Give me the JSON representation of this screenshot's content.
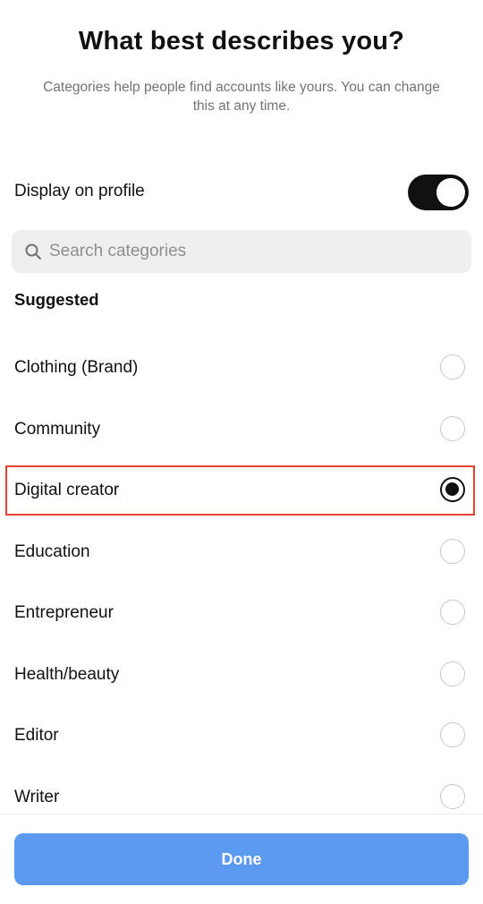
{
  "header": {
    "title": "What best describes you?",
    "subtitle": "Categories help people find accounts like yours. You can change this at any time."
  },
  "display_on_profile": {
    "label": "Display on profile",
    "enabled": true
  },
  "search": {
    "icon": "search-icon",
    "placeholder": "Search categories",
    "value": ""
  },
  "suggested": {
    "heading": "Suggested",
    "items": [
      {
        "label": "Clothing (Brand)",
        "selected": false
      },
      {
        "label": "Community",
        "selected": false
      },
      {
        "label": "Digital creator",
        "selected": true,
        "highlighted": true
      },
      {
        "label": "Education",
        "selected": false
      },
      {
        "label": "Entrepreneur",
        "selected": false
      },
      {
        "label": "Health/beauty",
        "selected": false
      },
      {
        "label": "Editor",
        "selected": false
      },
      {
        "label": "Writer",
        "selected": false
      }
    ]
  },
  "footer": {
    "done_label": "Done"
  },
  "colors": {
    "accent_button": "#5c99f0",
    "highlight": "#e8432f",
    "toggle_on": "#111111",
    "muted_text": "#737373"
  }
}
